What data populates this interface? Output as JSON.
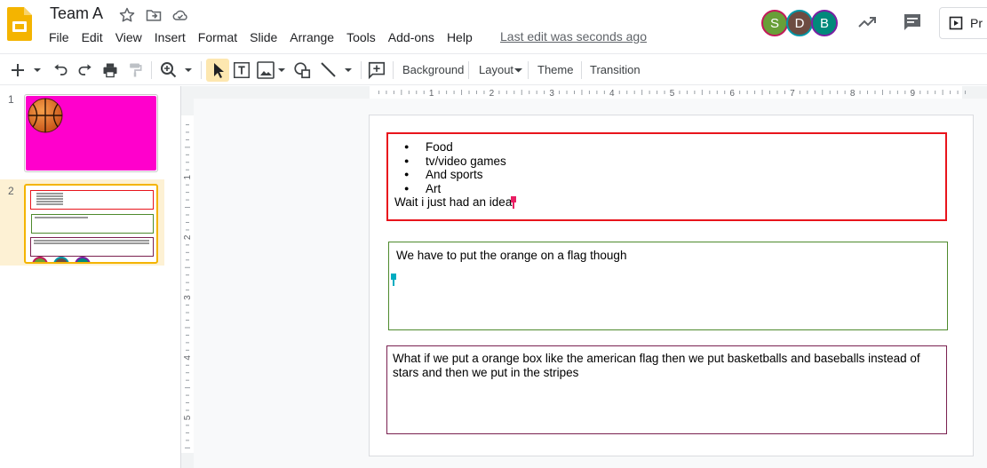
{
  "app": {
    "doc_title": "Team A",
    "menu": [
      "File",
      "Edit",
      "View",
      "Insert",
      "Format",
      "Slide",
      "Arrange",
      "Tools",
      "Add-ons",
      "Help"
    ],
    "last_edit": "Last edit was seconds ago",
    "collaborators": [
      {
        "initial": "S",
        "color": "#689f38",
        "ring": "#c2185b"
      },
      {
        "initial": "D",
        "color": "#6d4c41",
        "ring": "#0097a7"
      },
      {
        "initial": "B",
        "color": "#00897b",
        "ring": "#7b1fa2"
      }
    ],
    "present_label": "Pr"
  },
  "toolbar": {
    "background": "Background",
    "layout": "Layout",
    "theme": "Theme",
    "transition": "Transition"
  },
  "filmstrip": {
    "slides": [
      {
        "number": "1",
        "background": "#ff00cc",
        "icon": "basketball-icon"
      },
      {
        "number": "2",
        "selected": true
      }
    ]
  },
  "ruler": {
    "horizontal_ticks": [
      "1",
      "2",
      "3",
      "4",
      "5",
      "6",
      "7",
      "8",
      "9"
    ],
    "vertical_ticks": [
      "1",
      "2",
      "3",
      "4",
      "5"
    ]
  },
  "slide": {
    "box1": {
      "bullets": [
        "Food",
        "tv/video games",
        "And sports",
        "Art"
      ],
      "line": "Wait i just had an idea",
      "border_color": "#e8141c",
      "cursor_color": "#e91e63"
    },
    "box2": {
      "text": "We have to put the orange on a flag though",
      "border_color": "#4e8a2d",
      "cursor_color": "#00acc1"
    },
    "box3": {
      "text": "What if we put a orange box like the american flag then we put basketballs and baseballs instead of stars and then we put in the stripes",
      "border_color": "#7a2150"
    }
  }
}
